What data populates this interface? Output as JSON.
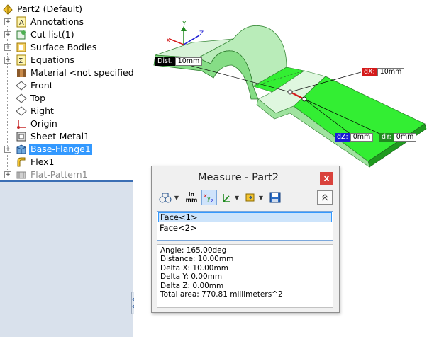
{
  "tree": {
    "root": "Part2  (Default)",
    "items": [
      {
        "label": "Annotations",
        "icon": "annotations-icon",
        "expandable": true
      },
      {
        "label": "Cut list(1)",
        "icon": "cut-list-icon",
        "expandable": true
      },
      {
        "label": "Surface Bodies",
        "icon": "surface-bodies-icon",
        "expandable": true
      },
      {
        "label": "Equations",
        "icon": "equations-icon",
        "expandable": true
      },
      {
        "label": "Material <not specified>",
        "icon": "material-icon",
        "expandable": false
      },
      {
        "label": "Front",
        "icon": "plane-icon",
        "expandable": false
      },
      {
        "label": "Top",
        "icon": "plane-icon",
        "expandable": false
      },
      {
        "label": "Right",
        "icon": "plane-icon",
        "expandable": false
      },
      {
        "label": "Origin",
        "icon": "origin-icon",
        "expandable": false
      },
      {
        "label": "Sheet-Metal1",
        "icon": "sheet-metal-icon",
        "expandable": false
      },
      {
        "label": "Base-Flange1",
        "icon": "base-flange-icon",
        "expandable": true,
        "selected": true
      },
      {
        "label": "Flex1",
        "icon": "flex-icon",
        "expandable": false
      },
      {
        "label": "Flat-Pattern1",
        "icon": "flat-pattern-icon",
        "expandable": true,
        "dimmed": true
      }
    ]
  },
  "viewport": {
    "dist_key": "Dist.",
    "dist_value": "10mm",
    "dx_key": "dX:",
    "dx_value": "10mm",
    "dy_key": "dY:",
    "dy_value": "0mm",
    "dz_key": "dZ:",
    "dz_value": "0mm",
    "colors": {
      "highlight": "#33ee33",
      "part": "#bff0bf",
      "dx": "#d41a1a",
      "dy": "#1f8a1f",
      "dz": "#1a1ad4",
      "dist": "#000000"
    }
  },
  "measure": {
    "title": "Measure - Part2",
    "close": "x",
    "units_label_top": "in",
    "units_label_bottom": "mm",
    "selections": [
      "Face<1>",
      "Face<2>"
    ],
    "results": [
      "Angle: 165.00deg",
      "Distance: 10.00mm",
      "Delta X: 10.00mm",
      "Delta Y: 0.00mm",
      "Delta Z: 0.00mm",
      "Total area: 770.81 millimeters^2"
    ]
  }
}
